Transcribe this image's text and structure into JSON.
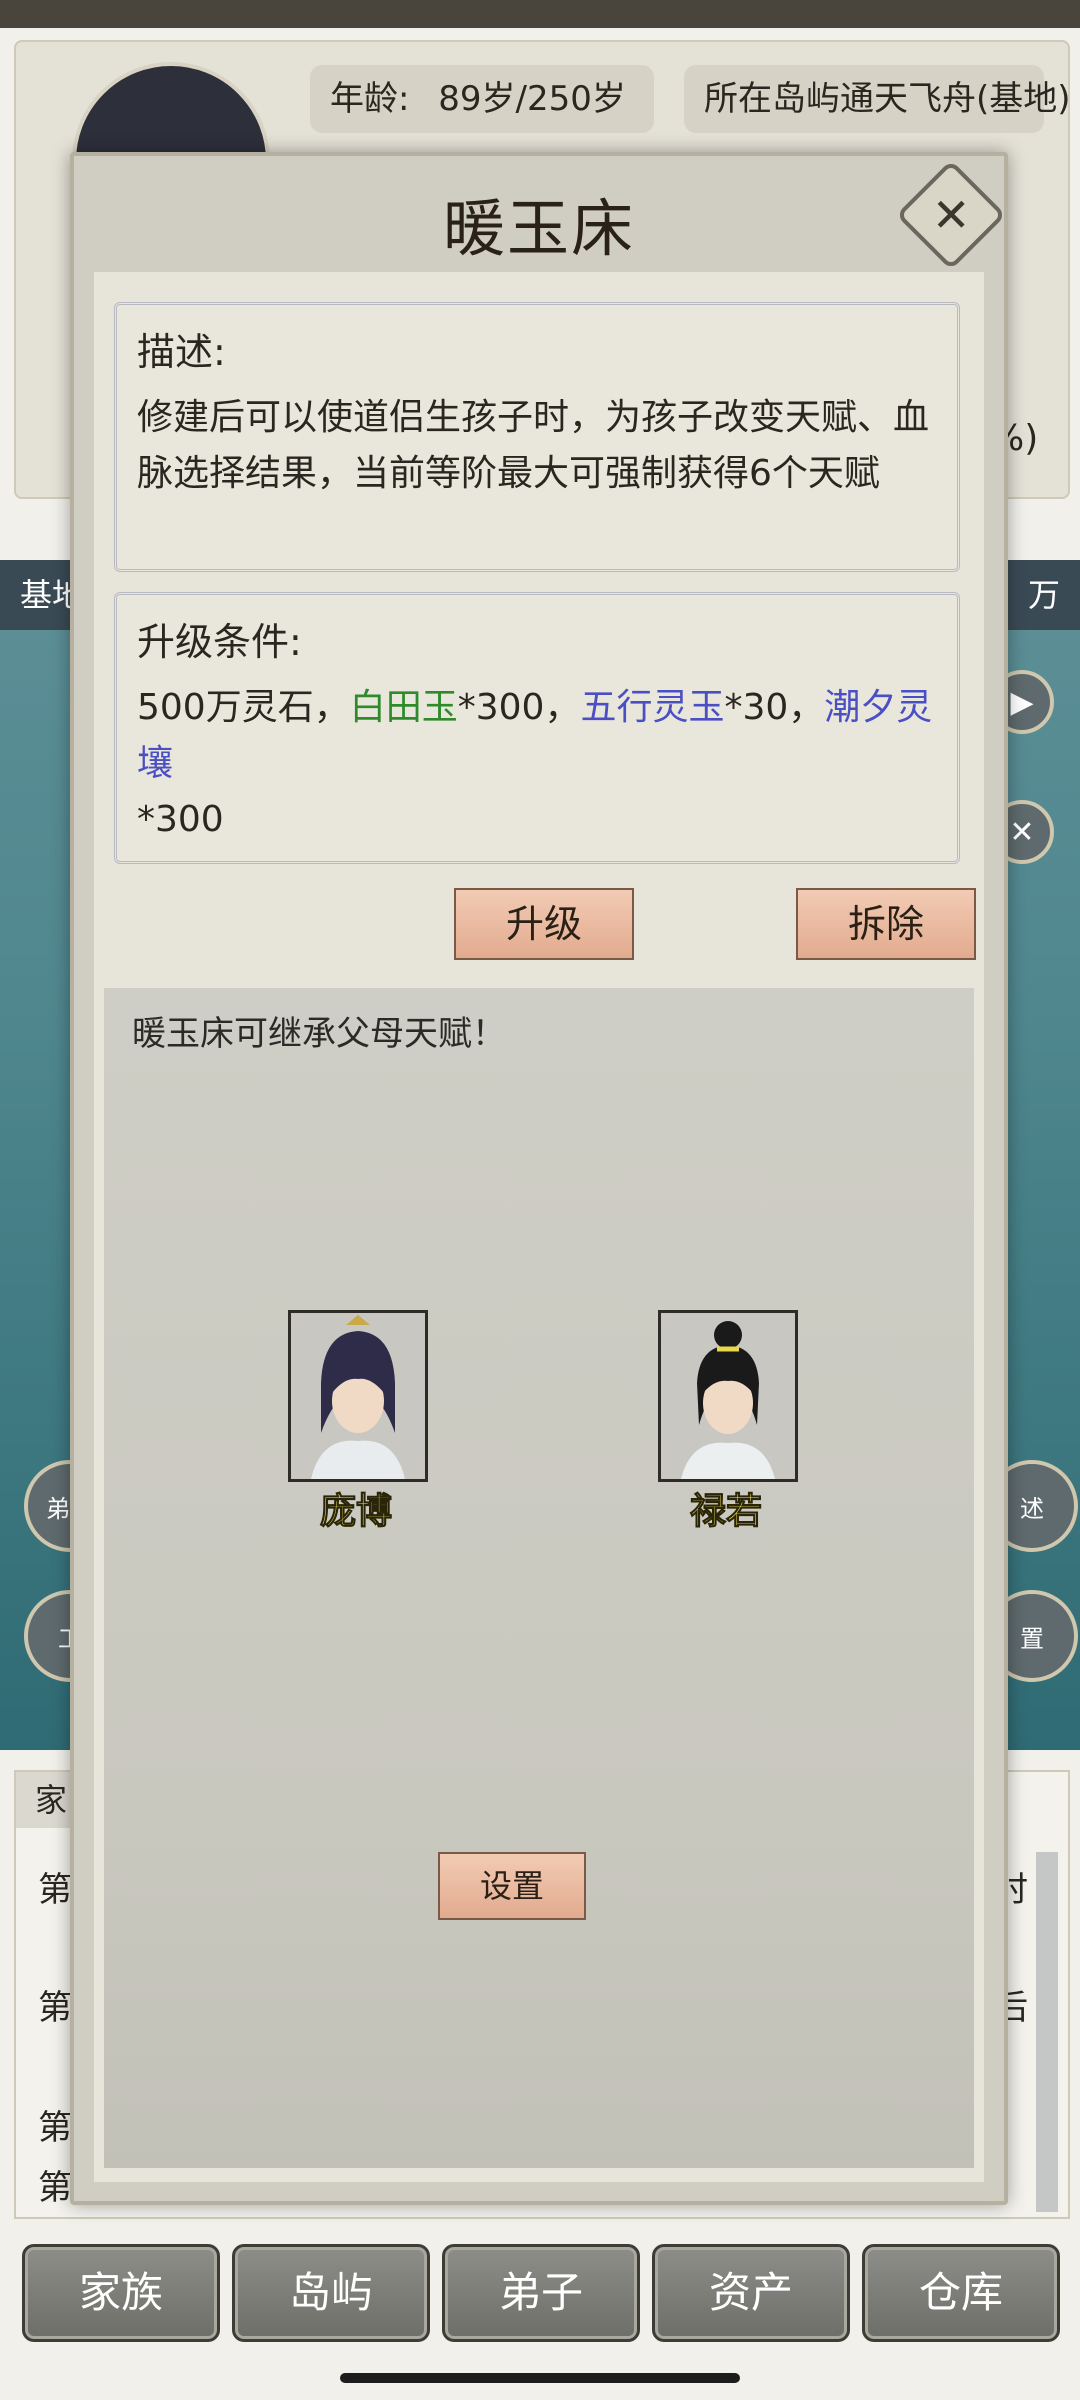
{
  "background": {
    "age_label": "年龄:",
    "age_value": "89岁/250岁",
    "island_label": "所在岛屿",
    "island_value": "通天飞舟(基地)",
    "percent_suffix": "%)",
    "map_left_label": "基地",
    "map_right_label": "万",
    "side_left_1": "弟子",
    "side_left_2": "工",
    "side_right_1": "述",
    "side_right_2": "置",
    "lower_tab": "家",
    "lower_rows": [
      "第",
      "第",
      "第",
      "第"
    ],
    "lower_right_rows": [
      "时",
      "后"
    ]
  },
  "modal": {
    "title": "暖玉床",
    "description_title": "描述:",
    "description_text": "修建后可以使道侣生孩子时，为孩子改变天赋、血脉选择结果，当前等阶最大可强制获得6个天赋",
    "upgrade_title": "升级条件:",
    "upgrade_part1": "500万灵石，",
    "upgrade_item1": "白田玉",
    "upgrade_part2": "*300，",
    "upgrade_item2": "五行灵玉",
    "upgrade_part3": "*30，",
    "upgrade_item3": "潮夕灵壤",
    "upgrade_part4": "*300",
    "upgrade_button": "升级",
    "demolish_button": "拆除",
    "inherit_notice": "暖玉床可继承父母天赋！",
    "parent1_name": "庞博",
    "parent2_name": "禄若",
    "settings_button": "设置"
  },
  "nav": {
    "items": [
      "家族",
      "岛屿",
      "弟子",
      "资产",
      "仓库"
    ]
  },
  "colors": {
    "green_item": "#2f8a2b",
    "blue_item": "#4b4fc4",
    "name_yellow": "#f1e35a"
  }
}
